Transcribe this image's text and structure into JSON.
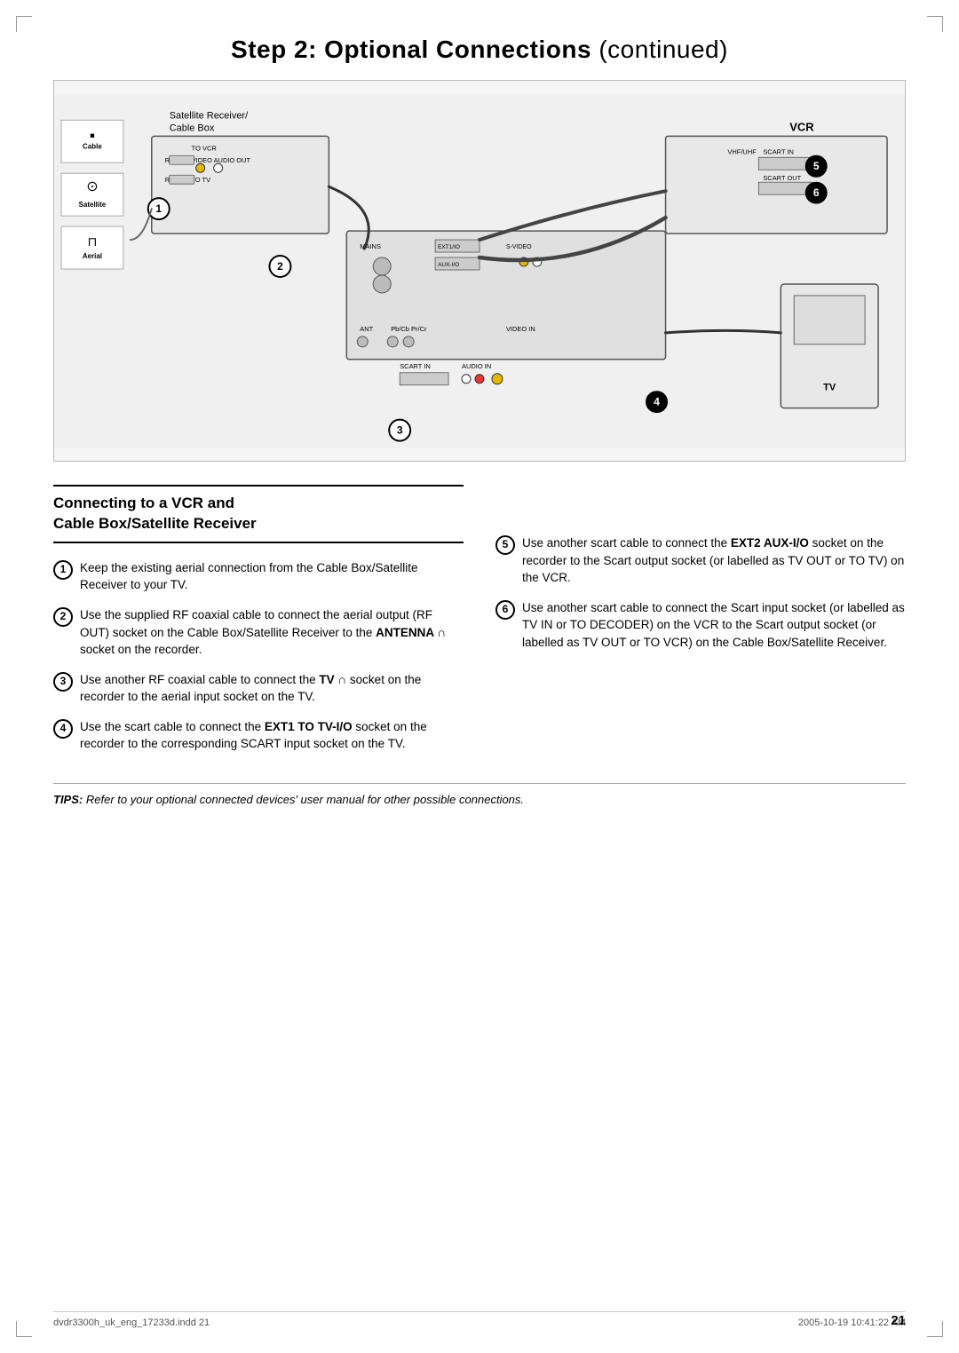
{
  "page": {
    "title": "Step 2: Optional Connections",
    "title_suffix": "continued",
    "page_number": "21"
  },
  "footer": {
    "left": "dvdr3300h_uk_eng_17233d.indd  21",
    "right": "2005-10-19  10:41:22 AM"
  },
  "section": {
    "heading_line1": "Connecting to a VCR and",
    "heading_line2": "Cable Box/Satellite Receiver"
  },
  "diagram": {
    "satellite_label": "Satellite Receiver/",
    "cable_box_label": "Cable Box",
    "vcr_label": "VCR",
    "tv_label": "TV",
    "num1": "1",
    "num2": "2",
    "num3": "3",
    "num4": "4",
    "num5": "5",
    "num6": "6",
    "side_cable": "Cable",
    "side_satellite": "Satellite",
    "side_aerial": "Aerial"
  },
  "left_instructions": [
    {
      "num": "1",
      "text": "Keep the existing aerial connection from the Cable Box/Satellite Receiver to your TV."
    },
    {
      "num": "2",
      "text": "Use the supplied RF coaxial cable to connect the aerial output (RF OUT) socket on the Cable Box/Satellite Receiver to the ",
      "bold_part": "ANTENNA",
      "antenna_symbol": "G",
      "text_end": " socket on the recorder."
    },
    {
      "num": "3",
      "text": "Use another RF coaxial cable to connect the ",
      "bold_part": "TV",
      "tv_symbol": "G",
      "text_end": " socket on the recorder to the aerial input socket on the TV."
    },
    {
      "num": "4",
      "text": "Use the scart cable to connect the ",
      "bold_part": "EXT1 TO TV-I/O",
      "text_end": " socket on the recorder to the corresponding SCART input socket on the TV."
    }
  ],
  "right_instructions": [
    {
      "num": "5",
      "text": "Use another scart cable to connect the ",
      "bold_part": "EXT2 AUX-I/O",
      "text_end": " socket on the recorder to the Scart output socket (or labelled as TV OUT or TO TV) on the VCR."
    },
    {
      "num": "6",
      "text": "Use another scart cable to connect the Scart input socket (or labelled as TV IN or TO DECODER) on the VCR to the Scart output socket (or labelled as TV OUT or TO VCR) on the Cable Box/Satellite Receiver."
    }
  ],
  "tips": {
    "label": "TIPS:",
    "text": "  Refer to your optional connected devices' user manual for other possible connections."
  }
}
